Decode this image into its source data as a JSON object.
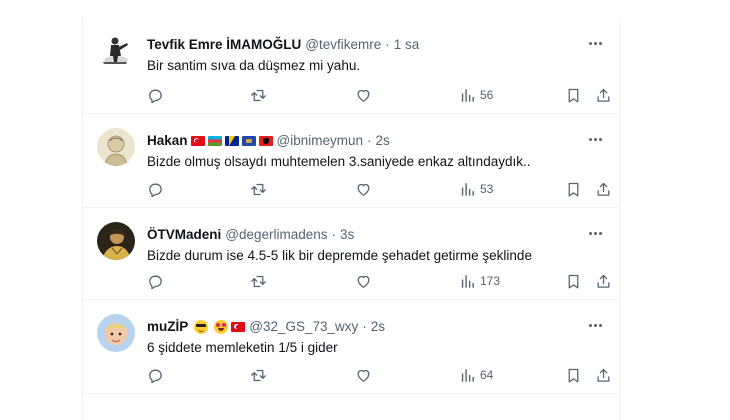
{
  "tweets": [
    {
      "name": "Tevfik Emre İMAMOĞLU",
      "handle": "@tevfikemre",
      "separator": "·",
      "time": "1 sa",
      "text": "Bir santim sıva da düşmez mi yahu.",
      "views": "56",
      "avatar_icon": "silhouette-avatar",
      "badges": []
    },
    {
      "name": "Hakan",
      "handle": "@ibnimeymun",
      "separator": "·",
      "time": "2s",
      "text": "Bizde olmuş olsaydı muhtemelen 3.saniyede enkaz altındaydık..",
      "views": "53",
      "avatar_icon": "sketch-portrait-avatar",
      "badges": [
        "turkey-flag",
        "azerbaijan-flag",
        "bosnia-flag",
        "kosovo-flag",
        "albania-flag"
      ]
    },
    {
      "name": "ÖTVMadeni",
      "handle": "@degerlimadens",
      "separator": "·",
      "time": "3s",
      "text": "Bizde durum ise 4.5-5 lik bir depremde şehadet getirme şeklinde",
      "views": "173",
      "avatar_icon": "portrait-avatar",
      "badges": []
    },
    {
      "name": "muZİP",
      "handle": "@32_GS_73_wxy",
      "separator": "·",
      "time": "2s",
      "text": "6 şiddete memleketin 1/5 i gider",
      "views": "64",
      "avatar_icon": "child-photo-avatar",
      "badges": [
        "sunglasses-emoji",
        "heart-eyes-emoji",
        "turkey-flag"
      ]
    }
  ],
  "colors": {
    "text": "#0f1419",
    "secondary": "#536471",
    "border": "#eff3f4",
    "turkey_red": "#e30a17"
  }
}
